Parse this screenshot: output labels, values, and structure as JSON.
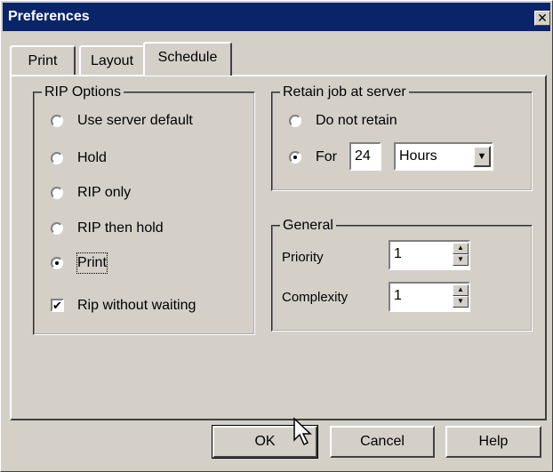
{
  "window": {
    "title": "Preferences",
    "close_symbol": "✕"
  },
  "tabs": [
    {
      "label": "Print"
    },
    {
      "label": "Layout"
    },
    {
      "label": "Schedule",
      "active": true
    }
  ],
  "rip_options": {
    "legend": "RIP Options",
    "options": [
      {
        "label": "Use server default",
        "selected": false
      },
      {
        "label": "Hold",
        "selected": false
      },
      {
        "label": "RIP only",
        "selected": false
      },
      {
        "label": "RIP then hold",
        "selected": false
      },
      {
        "label": "Print",
        "selected": true
      }
    ],
    "rip_without_waiting": {
      "label": "Rip without waiting",
      "checked": true,
      "mark": "✔"
    }
  },
  "retain": {
    "legend": "Retain job at server",
    "do_not_retain": {
      "label": "Do not retain",
      "selected": false
    },
    "for": {
      "label": "For",
      "selected": true,
      "value": "24",
      "unit": "Hours"
    }
  },
  "general": {
    "legend": "General",
    "priority": {
      "label": "Priority",
      "value": "1"
    },
    "complexity": {
      "label": "Complexity",
      "value": "1"
    }
  },
  "buttons": {
    "ok": "OK",
    "cancel": "Cancel",
    "help": "Help"
  },
  "glyphs": {
    "spin_up": "▲",
    "spin_down": "▼",
    "dropdown": "▼"
  }
}
